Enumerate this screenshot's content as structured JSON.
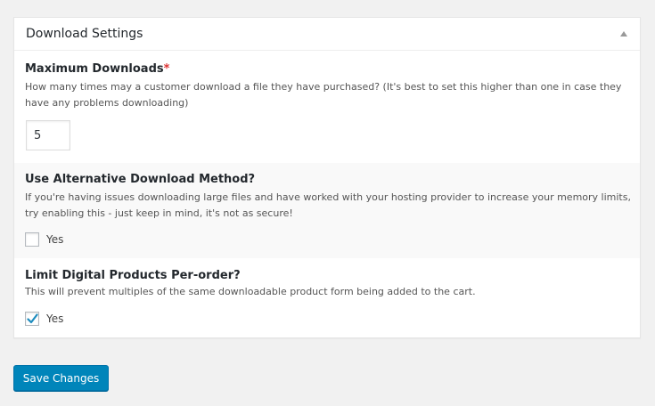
{
  "panel": {
    "title": "Download Settings",
    "toggle_icon": "triangle-up-icon"
  },
  "max_downloads": {
    "label": "Maximum Downloads",
    "required_mark": "*",
    "description": "How many times may a customer download a file they have purchased? (It's best to set this higher than one in case they have any problems downloading)",
    "value": "5"
  },
  "alt_download": {
    "label": "Use Alternative Download Method?",
    "description": "If you're having issues downloading large files and have worked with your hosting provider to increase your memory limits, try enabling this - just keep in mind, it's not as secure!",
    "option_label": "Yes",
    "checked": false
  },
  "limit_digital": {
    "label": "Limit Digital Products Per-order?",
    "description": "This will prevent multiples of the same downloadable product form being added to the cart.",
    "option_label": "Yes",
    "checked": true,
    "check_color": "#1e8cbe"
  },
  "actions": {
    "save_label": "Save Changes",
    "accent": "#0085ba"
  }
}
